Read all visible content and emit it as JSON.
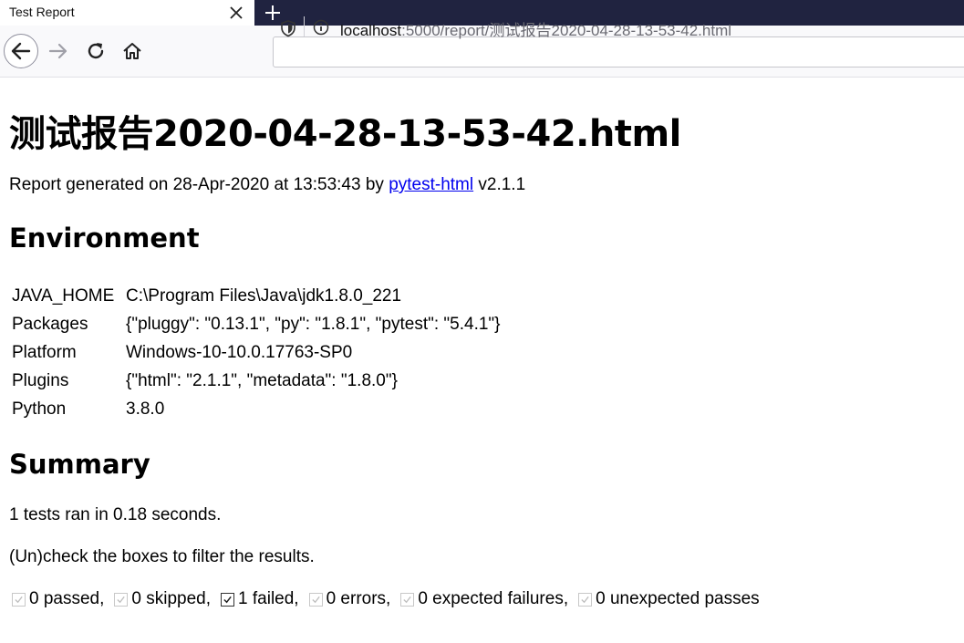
{
  "browser": {
    "tab_title": "Test Report",
    "url_host": "localhost",
    "url_rest": ":5000/report/测试报告2020-04-28-13-53-42.html"
  },
  "report": {
    "title": "测试报告2020-04-28-13-53-42.html",
    "generated_prefix": "Report generated on 28-Apr-2020 at 13:53:43 by ",
    "generator_link": "pytest-html",
    "generated_suffix": " v2.1.1",
    "environment_heading": "Environment",
    "environment": [
      {
        "key": "JAVA_HOME",
        "value": "C:\\Program Files\\Java\\jdk1.8.0_221"
      },
      {
        "key": "Packages",
        "value": "{\"pluggy\": \"0.13.1\", \"py\": \"1.8.1\", \"pytest\": \"5.4.1\"}"
      },
      {
        "key": "Platform",
        "value": "Windows-10-10.0.17763-SP0"
      },
      {
        "key": "Plugins",
        "value": "{\"html\": \"2.1.1\", \"metadata\": \"1.8.0\"}"
      },
      {
        "key": "Python",
        "value": "3.8.0"
      }
    ],
    "summary_heading": "Summary",
    "summary_line": "1 tests ran in 0.18 seconds.",
    "filter_hint": "(Un)check the boxes to filter the results.",
    "filters": [
      {
        "label": "0 passed,",
        "checked": true,
        "active": false
      },
      {
        "label": "0 skipped,",
        "checked": true,
        "active": false
      },
      {
        "label": "1 failed,",
        "checked": true,
        "active": true
      },
      {
        "label": "0 errors,",
        "checked": true,
        "active": false
      },
      {
        "label": "0 expected failures,",
        "checked": true,
        "active": false
      },
      {
        "label": "0 unexpected passes",
        "checked": true,
        "active": false
      }
    ]
  },
  "colors": {
    "tabbar_bg": "#202340",
    "link": "#0000ee"
  },
  "icons": {
    "close": "close-icon",
    "new_tab": "plus-icon",
    "back": "arrow-left-icon",
    "forward": "arrow-right-icon",
    "reload": "reload-icon",
    "home": "home-icon",
    "shield": "shield-icon",
    "info": "info-icon",
    "checkbox": "checkbox-icon"
  }
}
